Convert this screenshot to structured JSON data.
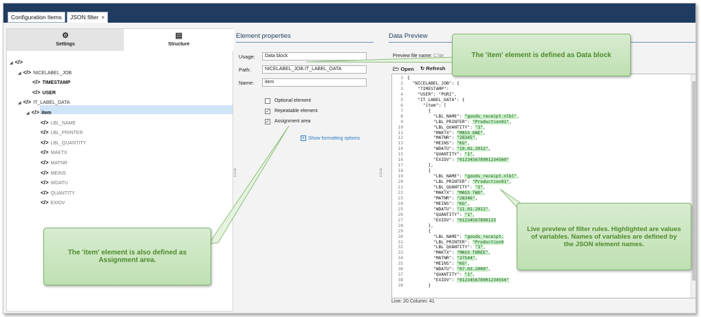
{
  "tabs": [
    {
      "label": "Configuration Items",
      "closable": false
    },
    {
      "label": "JSON filter",
      "closable": true,
      "close_glyph": "×"
    }
  ],
  "left_panel": {
    "segments": [
      {
        "label": "Settings",
        "icon": "settings-icon",
        "glyph": "⚙"
      },
      {
        "label": "Structure",
        "icon": "structure-icon",
        "glyph": "▤"
      }
    ],
    "tree": [
      {
        "label": "",
        "level": 0,
        "expanded": true,
        "style": "normal"
      },
      {
        "label": "NICELABEL_JOB",
        "level": 1,
        "expanded": true,
        "style": "normal"
      },
      {
        "label": "TIMESTAMP",
        "level": 2,
        "expanded": false,
        "style": "bold"
      },
      {
        "label": "USER",
        "level": 2,
        "expanded": false,
        "style": "bold"
      },
      {
        "label": "IT_LABEL_DATA",
        "level": 1,
        "expanded": true,
        "style": "normal"
      },
      {
        "label": "item",
        "level": 2,
        "expanded": true,
        "style": "bold",
        "selected": true
      },
      {
        "label": "LBL_NAME",
        "level": 3,
        "style": "gray"
      },
      {
        "label": "LBL_PRINTER",
        "level": 3,
        "style": "gray"
      },
      {
        "label": "LBL_QUANTITY",
        "level": 3,
        "style": "gray"
      },
      {
        "label": "MAKTX",
        "level": 3,
        "style": "gray"
      },
      {
        "label": "MATNR",
        "level": 3,
        "style": "gray"
      },
      {
        "label": "MEINS",
        "level": 3,
        "style": "gray"
      },
      {
        "label": "WDATU",
        "level": 3,
        "style": "gray"
      },
      {
        "label": "QUANTITY",
        "level": 3,
        "style": "gray"
      },
      {
        "label": "EXIDV",
        "level": 3,
        "style": "gray"
      }
    ],
    "tag_glyph": "</>"
  },
  "element_properties": {
    "title": "Element properties",
    "usage_label": "Usage:",
    "usage_value": "Data block",
    "path_label": "Path:",
    "path_value": "NICELABEL_JOB.IT_LABEL_DATA",
    "name_label": "Name:",
    "name_value": "item",
    "optional_label": "Optional element",
    "optional_checked": false,
    "repeatable_label": "Repeatable element",
    "repeatable_checked": true,
    "assignment_label": "Assignment area",
    "assignment_checked": true,
    "formatting_link": "Show formatting options",
    "check_glyph": "✓",
    "plus_glyph": "+"
  },
  "data_preview": {
    "title": "Data Preview",
    "preview_file_label": "Preview file name:",
    "preview_file_value": "C:\\te",
    "open_label": "Open",
    "refresh_label": "Refresh",
    "status_line": "Line: 20   Column: 41",
    "code": [
      {
        "n": "1",
        "parts": [
          [
            "{",
            false
          ]
        ]
      },
      {
        "n": "2",
        "parts": [
          [
            "  \"NICELABEL_JOB\": {",
            false
          ]
        ]
      },
      {
        "n": "3",
        "parts": [
          [
            "    \"TIMESTAMP\": ",
            false
          ]
        ]
      },
      {
        "n": "4",
        "parts": [
          [
            "    \"USER\": \"PGRI\",",
            false
          ]
        ]
      },
      {
        "n": "5",
        "parts": [
          [
            "    \"IT_LABEL_DATA\": {",
            false
          ]
        ]
      },
      {
        "n": "6",
        "parts": [
          [
            "      \"item\": [",
            false
          ]
        ]
      },
      {
        "n": "7",
        "parts": [
          [
            "        {",
            false
          ]
        ]
      },
      {
        "n": "8",
        "parts": [
          [
            "          \"LBL_NAME\": ",
            false
          ],
          [
            "\"goods_receipt.nlbl\"",
            true
          ],
          [
            ",",
            false
          ]
        ]
      },
      {
        "n": "9",
        "parts": [
          [
            "          \"LBL_PRINTER\": ",
            false
          ],
          [
            "\"Production01\"",
            true
          ],
          [
            ",",
            false
          ]
        ]
      },
      {
        "n": "10",
        "parts": [
          [
            "          \"LBL_QUANTITY\": ",
            false
          ],
          [
            "\"1\"",
            true
          ],
          [
            ",",
            false
          ]
        ]
      },
      {
        "n": "11",
        "parts": [
          [
            "          \"MAKTX\": ",
            false
          ],
          [
            "\"MASS ONE\"",
            true
          ],
          [
            ",",
            false
          ]
        ]
      },
      {
        "n": "12",
        "parts": [
          [
            "          \"MATNR\": ",
            false
          ],
          [
            "\"28345\"",
            true
          ],
          [
            ",",
            false
          ]
        ]
      },
      {
        "n": "13",
        "parts": [
          [
            "          \"MEINS\": ",
            false
          ],
          [
            "\"KG\"",
            true
          ],
          [
            ",",
            false
          ]
        ]
      },
      {
        "n": "14",
        "parts": [
          [
            "          \"WDATU\": ",
            false
          ],
          [
            "\"19.01.2012\"",
            true
          ],
          [
            ",",
            false
          ]
        ]
      },
      {
        "n": "15",
        "parts": [
          [
            "          \"QUANTITY\": ",
            false
          ],
          [
            "\"1\"",
            true
          ],
          [
            ",",
            false
          ]
        ]
      },
      {
        "n": "16",
        "parts": [
          [
            "          \"EXIDV\": ",
            false
          ],
          [
            "\"012345678901234560\"",
            true
          ]
        ]
      },
      {
        "n": "17",
        "parts": [
          [
            "        },",
            false
          ]
        ]
      },
      {
        "n": "18",
        "parts": [
          [
            "        {",
            false
          ]
        ]
      },
      {
        "n": "19",
        "parts": [
          [
            "          \"LBL_NAME\": ",
            false
          ],
          [
            "\"goods_receipt.nlbl\"",
            true
          ],
          [
            ",",
            false
          ]
        ]
      },
      {
        "n": "20",
        "parts": [
          [
            "          \"LBL_PRINTER\": ",
            false
          ],
          [
            "\"Production01\"",
            true
          ],
          [
            ",",
            false
          ]
        ]
      },
      {
        "n": "21",
        "parts": [
          [
            "          \"LBL_QUANTITY\": ",
            false
          ],
          [
            "\"1\"",
            true
          ],
          [
            ",",
            false
          ]
        ]
      },
      {
        "n": "22",
        "parts": [
          [
            "          \"MAKTX\": ",
            false
          ],
          [
            "\"MASS TWO\"",
            true
          ],
          [
            ",",
            false
          ]
        ]
      },
      {
        "n": "23",
        "parts": [
          [
            "          \"MATNR\": ",
            false
          ],
          [
            "\"28346\"",
            true
          ],
          [
            ",",
            false
          ]
        ]
      },
      {
        "n": "24",
        "parts": [
          [
            "          \"MEINS\": ",
            false
          ],
          [
            "\"KG\"",
            true
          ],
          [
            ",",
            false
          ]
        ]
      },
      {
        "n": "25",
        "parts": [
          [
            "          \"WDATU\": ",
            false
          ],
          [
            "\"11.01.2011\"",
            true
          ],
          [
            ",",
            false
          ]
        ]
      },
      {
        "n": "26",
        "parts": [
          [
            "          \"QUANTITY\": ",
            false
          ],
          [
            "\"1\"",
            true
          ],
          [
            ",",
            false
          ]
        ]
      },
      {
        "n": "27",
        "parts": [
          [
            "          \"EXIDV\": ",
            false
          ],
          [
            "\"01234567890123",
            true
          ]
        ]
      },
      {
        "n": "28",
        "parts": [
          [
            "        },",
            false
          ]
        ]
      },
      {
        "n": "29",
        "parts": [
          [
            "        {",
            false
          ]
        ]
      },
      {
        "n": "30",
        "parts": [
          [
            "          \"LBL_NAME\": ",
            false
          ],
          [
            "\"goods_receipt.",
            true
          ]
        ]
      },
      {
        "n": "31",
        "parts": [
          [
            "          \"LBL_PRINTER\": ",
            false
          ],
          [
            "\"Production0",
            true
          ]
        ]
      },
      {
        "n": "32",
        "parts": [
          [
            "          \"LBL_QUANTITY\": ",
            false
          ],
          [
            "\"1\"",
            true
          ],
          [
            ",",
            false
          ]
        ]
      },
      {
        "n": "33",
        "parts": [
          [
            "          \"MAKTX\": ",
            false
          ],
          [
            "\"MASS THREE\"",
            true
          ],
          [
            ",",
            false
          ]
        ]
      },
      {
        "n": "34",
        "parts": [
          [
            "          \"MATNR\": ",
            false
          ],
          [
            "\"27544\"",
            true
          ],
          [
            ",",
            false
          ]
        ]
      },
      {
        "n": "35",
        "parts": [
          [
            "          \"MEINS\": ",
            false
          ],
          [
            "\"KG\"",
            true
          ],
          [
            ",",
            false
          ]
        ]
      },
      {
        "n": "36",
        "parts": [
          [
            "          \"WDATU\": ",
            false
          ],
          [
            "\"07.03.2009\"",
            true
          ],
          [
            ",",
            false
          ]
        ]
      },
      {
        "n": "37",
        "parts": [
          [
            "          \"QUANTITY\": ",
            false
          ],
          [
            "\"1\"",
            true
          ],
          [
            ",",
            false
          ]
        ]
      },
      {
        "n": "38",
        "parts": [
          [
            "          \"EXIDV\": ",
            false
          ],
          [
            "\"012345678901234554\"",
            true
          ]
        ]
      },
      {
        "n": "39",
        "parts": [
          [
            "        }",
            false
          ]
        ]
      }
    ]
  },
  "callouts": {
    "data_block": "The 'item' element is defined as Data block",
    "assignment": "The 'item' element is also defined as Assignment area.",
    "live_preview": "Live preview of filter rules. Highlighted are values of variables. Names of variables are defined by the JSON element names."
  },
  "colors": {
    "tabbar": "#1f3b5f",
    "accent": "#2a7ac6",
    "selection": "#cfe4f7",
    "highlight": "#c9f0c9",
    "callout_text": "#4d8a2b"
  }
}
